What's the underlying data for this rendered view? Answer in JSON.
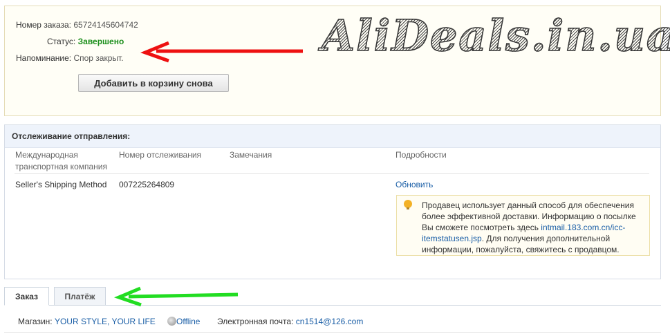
{
  "order": {
    "number_label": "Номер заказа:",
    "number_value": "65724145604742",
    "status_label": "Статус:",
    "status_value": "Завершено",
    "reminder_label": "Напоминание:",
    "reminder_value": "Спор закрыт.",
    "reorder_button": "Добавить в корзину снова"
  },
  "watermark": "AliDeals.in.ua",
  "tracking": {
    "title": "Отслеживание отправления:",
    "columns": {
      "carrier_l1": "Международная",
      "carrier_l2": "транспортная компания",
      "tracking_number": "Номер отслеживания",
      "remarks": "Замечания",
      "details": "Подробности"
    },
    "row": {
      "carrier": "Seller's Shipping Method",
      "tracking_number": "007225264809",
      "update_link": "Обновить"
    },
    "notice": {
      "part1": "Продавец использует данный способ для обеспечения более эффективной доставки. Информацию о посылке Вы сможете посмотреть здесь ",
      "link": "intmail.183.com.cn/icc-itemstatusen.jsp",
      "part2": ". Для получения дополнительной информации, пожалуйста, свяжитесь с продавцом."
    }
  },
  "tabs": {
    "order": "Заказ",
    "payment": "Платёж"
  },
  "store": {
    "label": "Магазин:",
    "name": "YOUR STYLE, YOUR LIFE",
    "presence": "Offline",
    "email_label": "Электронная почта:",
    "email": "cn1514@126.com"
  },
  "colors": {
    "status_green": "#1c8f1c",
    "link_blue": "#1a5ea6",
    "red_arrow": "#ee1111",
    "green_arrow": "#22dd22"
  }
}
